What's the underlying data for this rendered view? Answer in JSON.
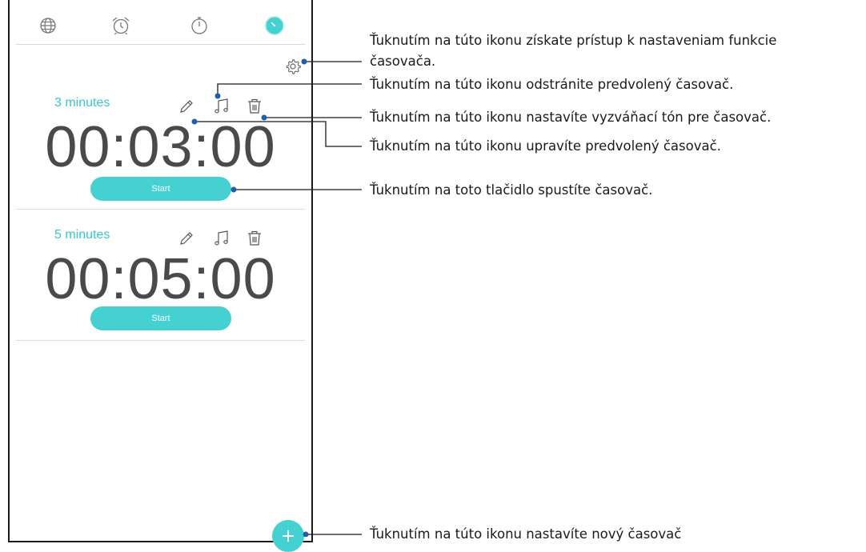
{
  "tabs": [
    {
      "name": "world-clock",
      "icon": "globe-icon",
      "active": false
    },
    {
      "name": "alarm",
      "icon": "alarm-clock-icon",
      "active": false
    },
    {
      "name": "stopwatch",
      "icon": "stopwatch-icon",
      "active": false
    },
    {
      "name": "timer",
      "icon": "timer-icon",
      "active": true
    }
  ],
  "settings_icon": "gear-icon",
  "timers": [
    {
      "name": "3 minutes",
      "time": "00:03:00",
      "start_label": "Start"
    },
    {
      "name": "5 minutes",
      "time": "00:05:00",
      "start_label": "Start"
    }
  ],
  "add_icon": "plus-icon",
  "callouts": {
    "settings_line1": "Ťuknutím na túto ikonu získate prístup k nastaveniam funkcie",
    "settings_line2": "časovača.",
    "delete": "Ťuknutím na túto ikonu odstránite predvolený časovač.",
    "ringtone": "Ťuknutím na túto ikonu nastavíte vyzváňací tón pre časovač.",
    "edit": "Ťuknutím na túto ikonu upravíte predvolený časovač.",
    "start": "Ťuknutím na toto tlačidlo spustíte časovač.",
    "add": "Ťuknutím na túto ikonu nastavíte nový časovač"
  },
  "colors": {
    "accent": "#45d1d1",
    "label": "#37c7c9",
    "digits": "#4a4a4a",
    "callout_line": "#1a1a1a",
    "callout_dot": "#1f5fa8"
  }
}
